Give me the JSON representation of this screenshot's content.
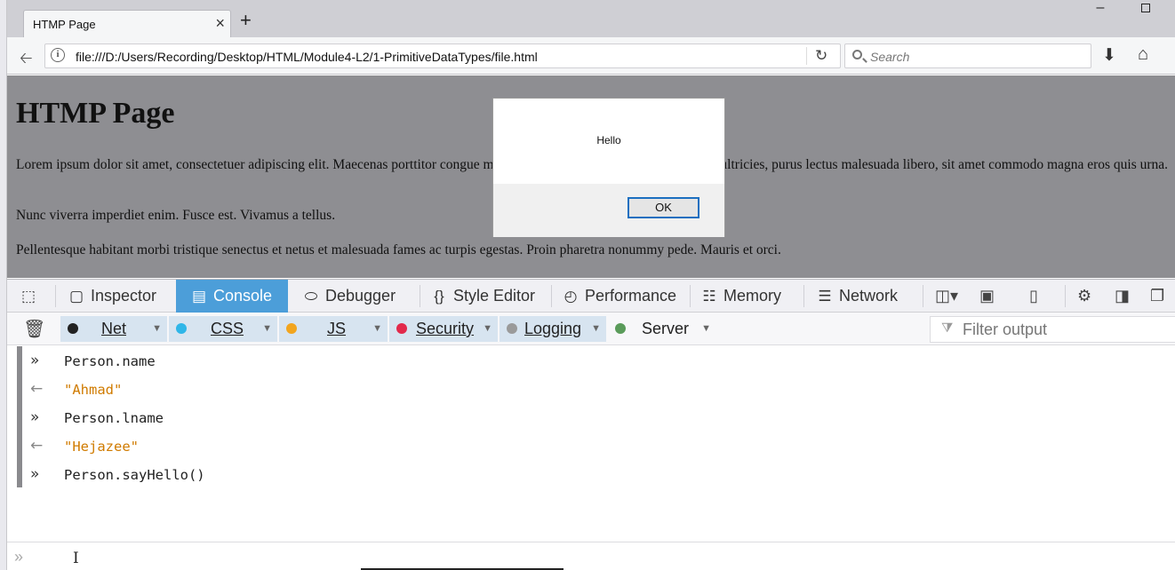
{
  "browser": {
    "tab_title": "HTMP Page",
    "tab_close_icon": "×",
    "new_tab_icon": "+",
    "minimize_icon": "–",
    "url": "file:///D:/Users/Recording/Desktop/HTML/Module4-L2/1-PrimitiveDataTypes/file.html",
    "search_placeholder": "Search"
  },
  "page": {
    "heading": "HTMP Page",
    "paragraphs": [
      "Lorem ipsum dolor sit amet, consectetuer adipiscing elit. Maecenas porttitor congue massa. Fusce posuere, magna sed pulvinar ultricies, purus lectus malesuada libero, sit amet commodo magna eros quis urna.",
      "Nunc viverra imperdiet enim. Fusce est. Vivamus a tellus.",
      "Pellentesque habitant morbi tristique senectus et netus et malesuada fames ac turpis egestas. Proin pharetra nonummy pede. Mauris et orci."
    ]
  },
  "alert": {
    "message": "Hello",
    "ok_label": "OK"
  },
  "devtools": {
    "tabs": [
      {
        "label": "Inspector",
        "icon": "inspector-icon"
      },
      {
        "label": "Console",
        "icon": "console-icon",
        "active": true
      },
      {
        "label": "Debugger",
        "icon": "debugger-icon"
      },
      {
        "label": "Style Editor",
        "icon": "braces-icon"
      },
      {
        "label": "Performance",
        "icon": "performance-icon"
      },
      {
        "label": "Memory",
        "icon": "memory-icon"
      },
      {
        "label": "Network",
        "icon": "network-icon"
      }
    ],
    "filters": [
      {
        "label": "Net",
        "color": "#222222",
        "active": true
      },
      {
        "label": "CSS",
        "color": "#2fb6e8",
        "active": true
      },
      {
        "label": "JS",
        "color": "#f2a51e",
        "active": true
      },
      {
        "label": "Security",
        "color": "#e2294b",
        "active": true
      },
      {
        "label": "Logging",
        "color": "#9a9a9a",
        "active": true
      },
      {
        "label": "Server",
        "color": "#5a9b5a",
        "active": false
      }
    ],
    "filter_placeholder": "Filter output",
    "console_rows": [
      {
        "type": "input",
        "text": "Person.name"
      },
      {
        "type": "output",
        "text": "\"Ahmad\""
      },
      {
        "type": "input",
        "text": "Person.lname"
      },
      {
        "type": "output",
        "text": "\"Hejazee\""
      },
      {
        "type": "input",
        "text": "Person.sayHello()"
      }
    ]
  },
  "colors": {
    "console_active": "#4c9ed9",
    "string_output": "#d07b00",
    "page_overlay": "#8e8e92"
  }
}
